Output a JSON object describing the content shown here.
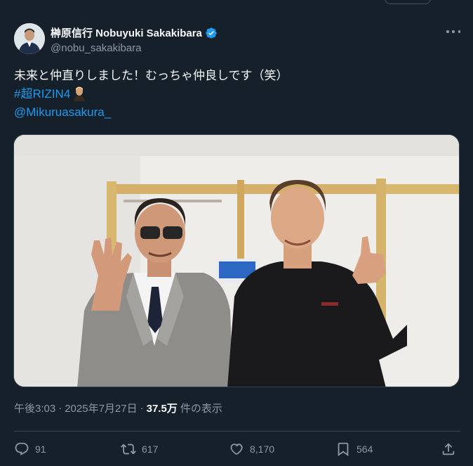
{
  "author": {
    "display_name": "榊原信行 Nobuyuki Sakakibara",
    "handle": "@nobu_sakakibara",
    "verified": true,
    "avatar_icon": "profile-photo"
  },
  "tweet": {
    "line1": "未来と仲直りしました！むっちゃ仲良しです（笑）",
    "hashtag": "#超RIZIN4",
    "hashtag_emoji": "portrait-emoji",
    "mention": "@Mikuruasakura_"
  },
  "media": {
    "type": "photo",
    "description_icon": "two-men-photo"
  },
  "meta": {
    "time": "午後3:03",
    "separator": "·",
    "date": "2025年7月27日",
    "views": "37.5万",
    "views_label": "件の表示"
  },
  "actions": {
    "replies": "91",
    "reposts": "617",
    "likes": "8,170",
    "bookmarks": "564"
  },
  "colors": {
    "background": "#15202b",
    "text": "#f7f9f9",
    "secondary": "#8b98a5",
    "accent": "#1d9bf0",
    "border": "#38444d"
  }
}
